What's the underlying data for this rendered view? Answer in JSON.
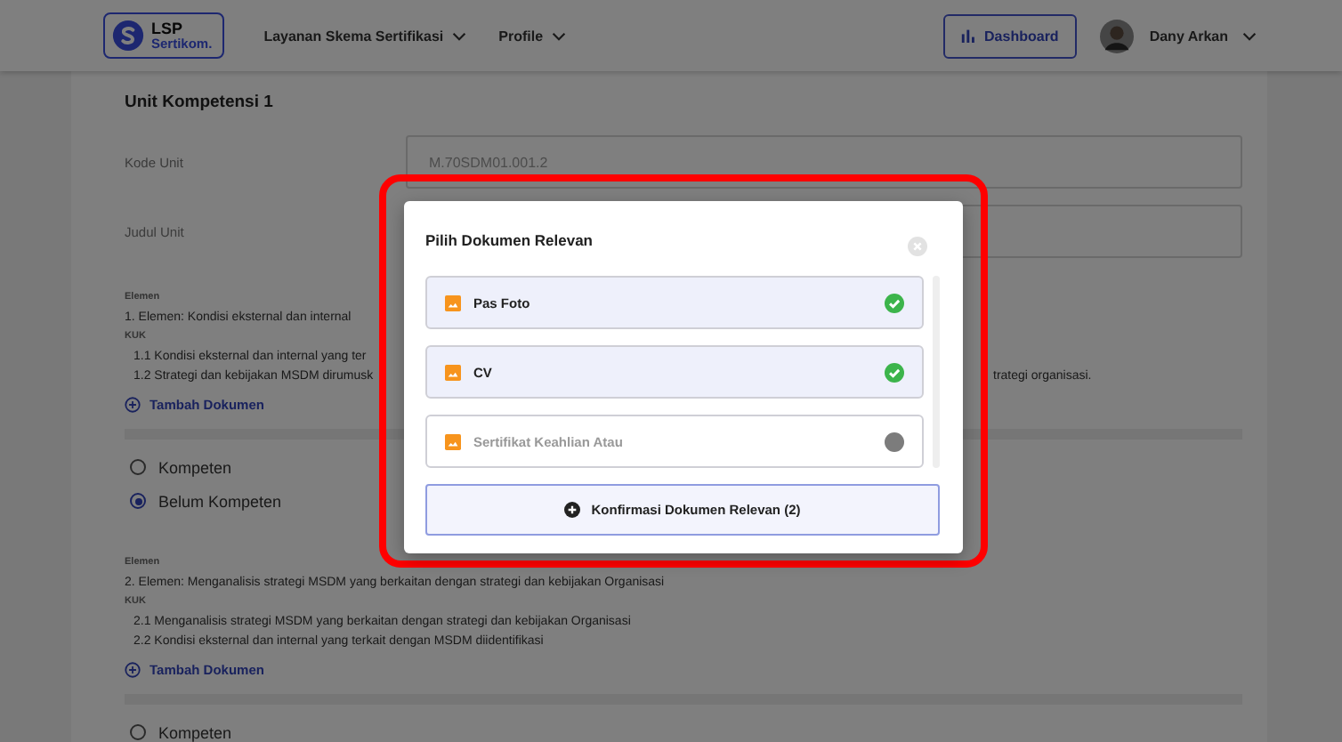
{
  "navbar": {
    "logo_top": "LSP",
    "logo_bottom": "Sertikom.",
    "menu": [
      {
        "label": "Layanan Skema Sertifikasi"
      },
      {
        "label": "Profile"
      }
    ],
    "dashboard_button": "Dashboard",
    "user_name": "Dany Arkan"
  },
  "unit": {
    "title": "Unit Kompetensi 1",
    "fields": [
      {
        "label": "Kode Unit",
        "value": "M.70SDM01.001.2"
      },
      {
        "label": "Judul Unit"
      }
    ],
    "elements": [
      {
        "section_label": "Elemen",
        "title": "1.  Elemen: Kondisi eksternal dan internal",
        "kuk_label": "KUK",
        "kuk": [
          {
            "text": "1.1  Kondisi eksternal dan internal yang ter"
          },
          {
            "text": "1.2  Strategi dan kebijakan MSDM dirumusk",
            "text_right": "trategi organisasi."
          }
        ],
        "add_link": "Tambah Dokumen",
        "options": [
          {
            "label": "Kompeten",
            "selected": false
          },
          {
            "label": "Belum Kompeten",
            "selected": true
          }
        ]
      },
      {
        "section_label": "Elemen",
        "title": "2.  Elemen: Menganalisis strategi MSDM yang berkaitan dengan strategi dan kebijakan Organisasi",
        "kuk_label": "KUK",
        "kuk": [
          {
            "text": "2.1  Menganalisis strategi MSDM yang berkaitan dengan strategi dan kebijakan Organisasi"
          },
          {
            "text": "2.2  Kondisi eksternal dan internal yang terkait dengan MSDM diidentifikasi"
          }
        ],
        "add_link": "Tambah Dokumen",
        "options": [
          {
            "label": "Kompeten",
            "selected": false
          }
        ]
      }
    ]
  },
  "modal": {
    "title": "Pilih Dokumen Relevan",
    "documents": [
      {
        "name": "Pas Foto",
        "selected": true
      },
      {
        "name": "CV",
        "selected": true
      },
      {
        "name": "Sertifikat Keahlian Atau",
        "selected": false
      }
    ],
    "confirm_button": "Konfirmasi Dokumen Relevan (2)"
  }
}
